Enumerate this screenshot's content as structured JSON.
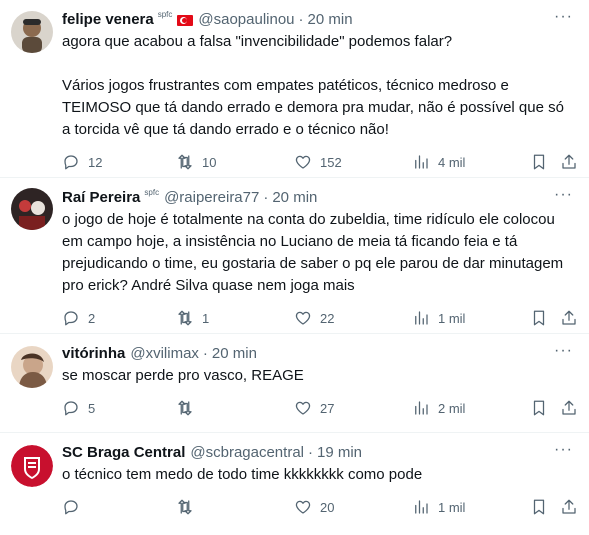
{
  "tweets": [
    {
      "name": "felipe venera",
      "badge": "spfc",
      "flag": true,
      "handle": "@saopaulinou",
      "dot": "·",
      "time": "20 min",
      "text": "agora que acabou a falsa \"invencibilidade\" podemos falar?\n\nVários jogos frustrantes com empates patéticos, técnico medroso e TEIMOSO que tá dando errado e demora pra mudar, não é possível que só a torcida vê que tá dando errado e o técnico não!",
      "replies": "12",
      "retweets": "10",
      "likes": "152",
      "views": "4 mil",
      "avatar_color": "#8b7d6b"
    },
    {
      "name": "Raí Pereira",
      "badge": "spfc",
      "flag": false,
      "handle": "@raipereira77",
      "dot": "·",
      "time": "20 min",
      "text": "o jogo de hoje é totalmente na conta do zubeldia, time ridículo ele colocou em campo hoje, a insistência no Luciano de meia tá ficando feia e tá prejudicando o time, eu gostaria de saber o pq ele parou de dar minutagem pro erick? André Silva quase nem joga mais",
      "replies": "2",
      "retweets": "1",
      "likes": "22",
      "views": "1 mil",
      "avatar_color": "#3a2a2a"
    },
    {
      "name": "vitórinha",
      "badge": "",
      "flag": false,
      "handle": "@xvilimax",
      "dot": "·",
      "time": "20 min",
      "text": "se moscar perde pro vasco, REAGE",
      "replies": "5",
      "retweets": "",
      "likes": "27",
      "views": "2 mil",
      "avatar_color": "#c9a58a"
    },
    {
      "name": "SC Braga Central",
      "badge": "",
      "flag": false,
      "handle": "@scbragacentral",
      "dot": "·",
      "time": "19 min",
      "text": "o técnico tem medo de todo time kkkkkkkk como pode",
      "replies": "",
      "retweets": "",
      "likes": "20",
      "views": "1 mil",
      "avatar_color": "#c8102e"
    }
  ],
  "more_glyph": "···",
  "colors": {
    "text": "#0f1419",
    "muted": "#536471",
    "divider": "#eff3f4",
    "flag_red": "#e30a17"
  }
}
